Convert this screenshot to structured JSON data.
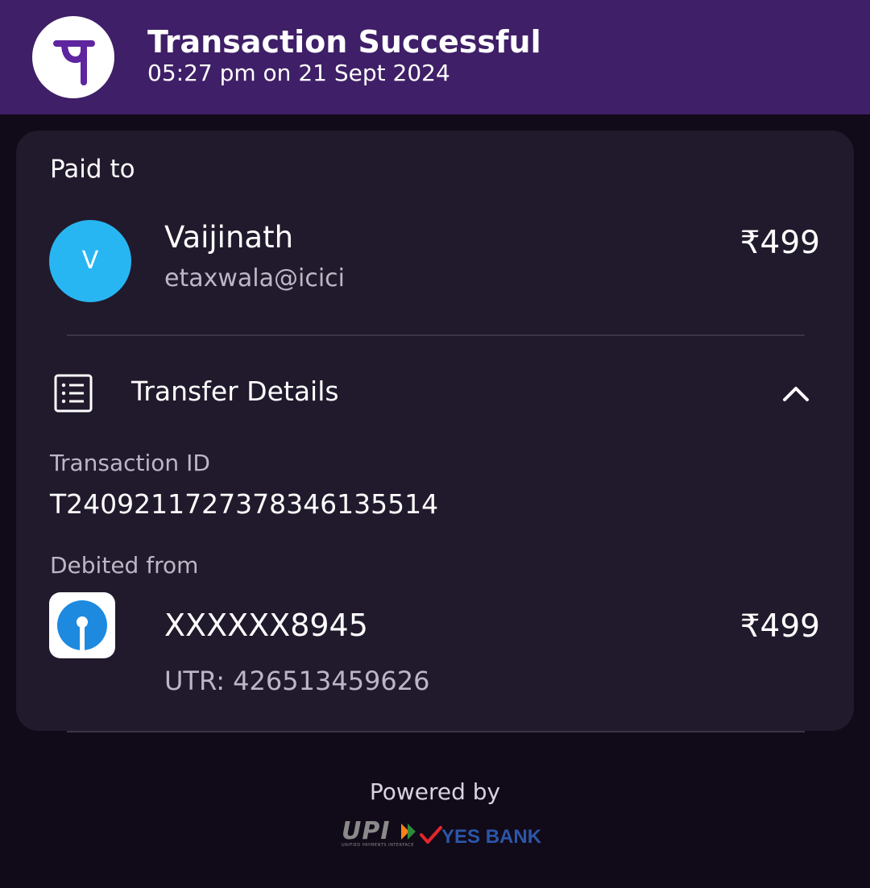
{
  "header": {
    "title": "Transaction Successful",
    "timestamp": "05:27 pm on 21 Sept 2024",
    "logo_icon": "phonepe-logo-icon",
    "background": "#3f1f67"
  },
  "paid_to": {
    "label": "Paid to",
    "avatar_initial": "V",
    "avatar_color": "#28b6f3",
    "name": "Vaijinath",
    "upi_id": "etaxwala@icici",
    "amount": "₹499"
  },
  "transfer_details": {
    "title": "Transfer Details",
    "icon": "receipt-list-icon",
    "toggle_icon": "chevron-up-icon",
    "transaction_id_label": "Transaction ID",
    "transaction_id": "T2409211727378346135514",
    "debited_from_label": "Debited from",
    "bank_icon": "sbi-bank-logo-icon",
    "account_number": "XXXXXX8945",
    "utr": "UTR: 426513459626",
    "amount": "₹499"
  },
  "footer": {
    "powered_by": "Powered by",
    "upi_logo_text": "UPI",
    "upi_tagline": "UNIFIED PAYMENTS INTERFACE",
    "bank_name": "YES BANK"
  }
}
